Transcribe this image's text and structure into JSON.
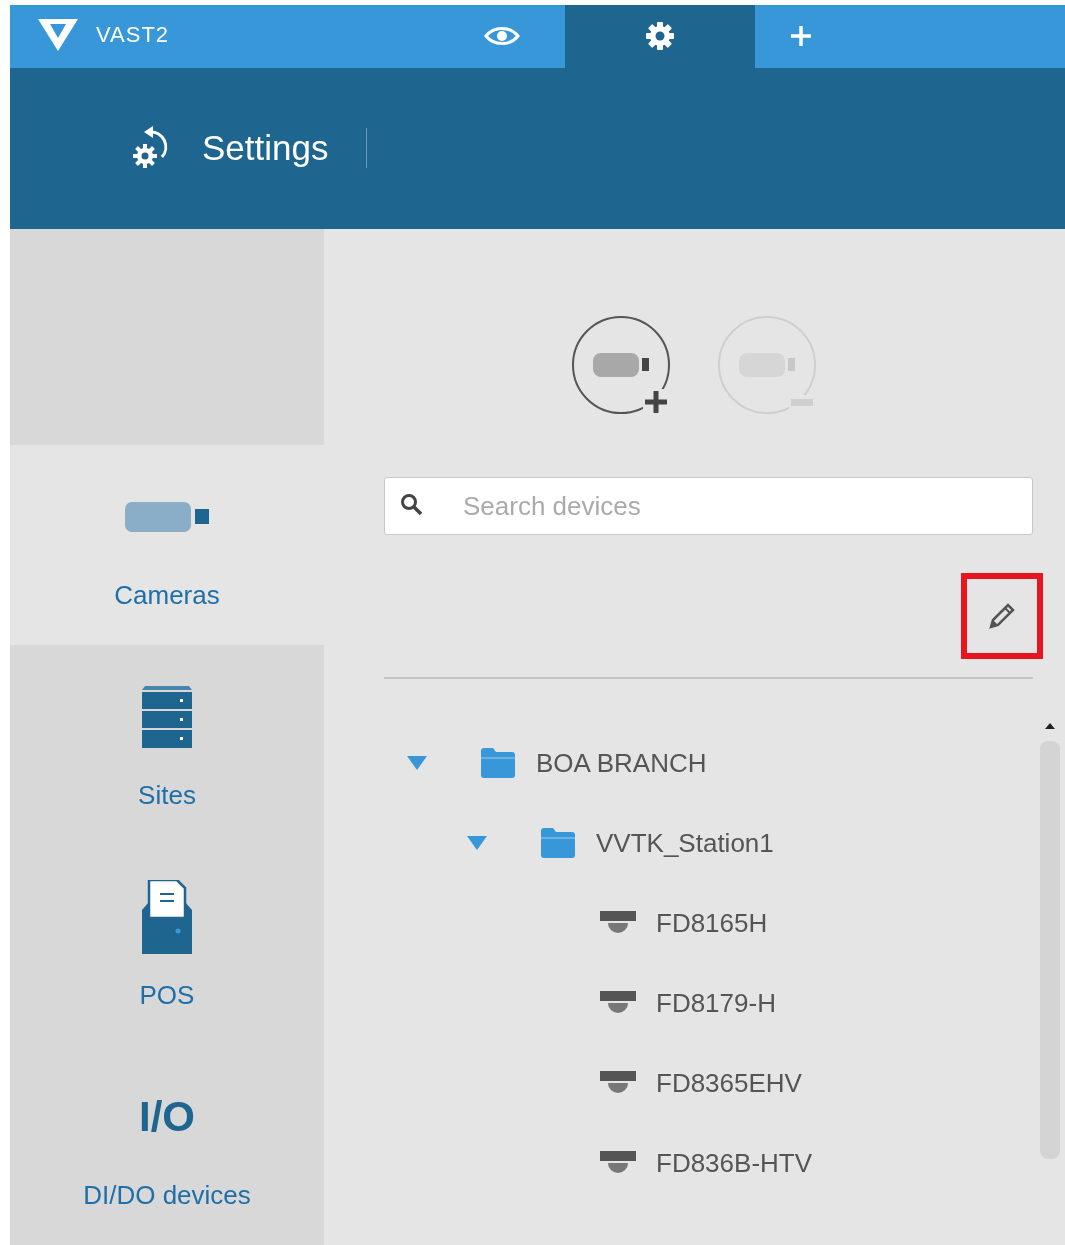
{
  "app": {
    "name": "VAST2"
  },
  "top_tabs": [
    {
      "kind": "view",
      "selected": false
    },
    {
      "kind": "settings",
      "selected": true
    },
    {
      "kind": "add",
      "selected": false
    }
  ],
  "header": {
    "title": "Settings"
  },
  "sidebar": {
    "items": [
      {
        "kind": "camera",
        "label": "Cameras",
        "selected": true
      },
      {
        "kind": "server",
        "label": "Sites",
        "selected": false
      },
      {
        "kind": "pos",
        "label": "POS",
        "selected": false
      },
      {
        "kind": "text",
        "icon_text": "I/O",
        "label": "DI/DO devices",
        "selected": false
      }
    ]
  },
  "device_buttons": [
    {
      "kind": "add",
      "disabled": false
    },
    {
      "kind": "remove",
      "disabled": true
    }
  ],
  "search": {
    "placeholder": "Search devices"
  },
  "edit_button": {
    "highlighted": true
  },
  "tree": [
    {
      "kind": "folder",
      "label": "BOA BRANCH",
      "expanded": true,
      "children": [
        {
          "kind": "folder",
          "label": "VVTK_Station1",
          "expanded": true,
          "children": [
            {
              "kind": "camera",
              "label": "FD8165H"
            },
            {
              "kind": "camera",
              "label": "FD8179-H"
            },
            {
              "kind": "camera",
              "label": "FD8365EHV"
            },
            {
              "kind": "camera",
              "label": "FD836B-HTV"
            }
          ]
        }
      ]
    }
  ]
}
